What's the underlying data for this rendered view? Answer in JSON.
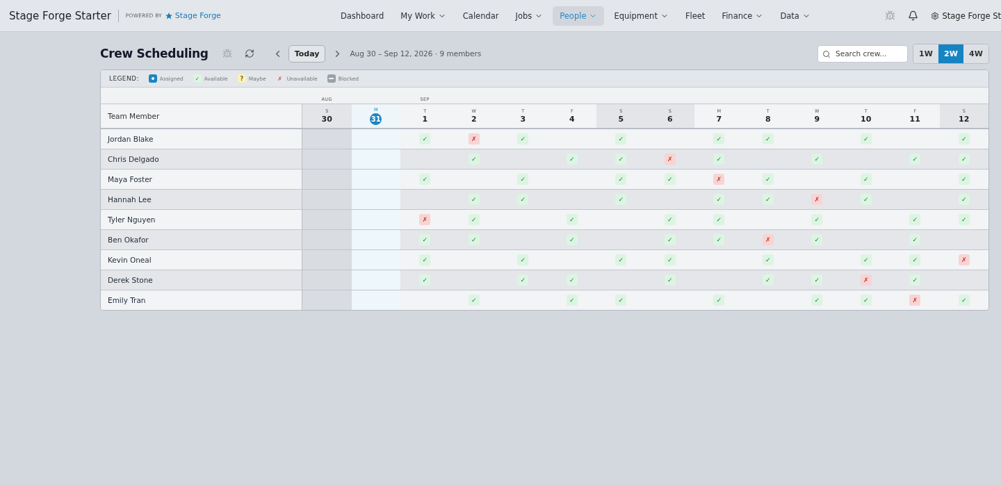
{
  "brand": {
    "title": "Stage Forge Starter",
    "powered_by": "POWERED BY",
    "partner": "Stage Forge"
  },
  "nav": [
    {
      "label": "Dashboard",
      "dropdown": false,
      "selected": false
    },
    {
      "label": "My Work",
      "dropdown": true,
      "selected": false
    },
    {
      "label": "Calendar",
      "dropdown": false,
      "selected": false
    },
    {
      "label": "Jobs",
      "dropdown": true,
      "selected": false
    },
    {
      "label": "People",
      "dropdown": true,
      "selected": true
    },
    {
      "label": "Equipment",
      "dropdown": true,
      "selected": false
    },
    {
      "label": "Fleet",
      "dropdown": false,
      "selected": false
    },
    {
      "label": "Finance",
      "dropdown": true,
      "selected": false
    },
    {
      "label": "Data",
      "dropdown": true,
      "selected": false
    }
  ],
  "account": "Stage Forge St",
  "page": {
    "title": "Crew Scheduling",
    "today_button": "Today",
    "range": "Aug 30 – Sep 12, 2026 · 9 members",
    "search": {
      "placeholder": "Search crew..."
    },
    "views": [
      {
        "label": "1W",
        "selected": false
      },
      {
        "label": "2W",
        "selected": true
      },
      {
        "label": "4W",
        "selected": false
      }
    ]
  },
  "legend": {
    "label": "LEGEND:",
    "items": [
      {
        "kind": "assigned",
        "label": "Assigned"
      },
      {
        "kind": "available",
        "mark": "✓",
        "label": "Available"
      },
      {
        "kind": "maybe",
        "mark": "?",
        "label": "Maybe"
      },
      {
        "kind": "unavailable",
        "mark": "✗",
        "label": "Unavailable"
      },
      {
        "kind": "blocked",
        "label": "Blocked"
      }
    ]
  },
  "grid": {
    "member_header": "Team Member",
    "days": [
      {
        "month": "AUG",
        "weekday": "S",
        "date": "30",
        "weekend": true,
        "today": false
      },
      {
        "weekday": "M",
        "date": "31",
        "weekend": false,
        "today": true
      },
      {
        "month": "SEP",
        "weekday": "T",
        "date": "1",
        "weekend": false,
        "today": false
      },
      {
        "weekday": "W",
        "date": "2",
        "weekend": false,
        "today": false
      },
      {
        "weekday": "T",
        "date": "3",
        "weekend": false,
        "today": false
      },
      {
        "weekday": "F",
        "date": "4",
        "weekend": false,
        "today": false
      },
      {
        "weekday": "S",
        "date": "5",
        "weekend": true,
        "today": false
      },
      {
        "weekday": "S",
        "date": "6",
        "weekend": true,
        "today": false
      },
      {
        "weekday": "M",
        "date": "7",
        "weekend": false,
        "today": false
      },
      {
        "weekday": "T",
        "date": "8",
        "weekend": false,
        "today": false
      },
      {
        "weekday": "W",
        "date": "9",
        "weekend": false,
        "today": false
      },
      {
        "weekday": "T",
        "date": "10",
        "weekend": false,
        "today": false
      },
      {
        "weekday": "F",
        "date": "11",
        "weekend": false,
        "today": false
      },
      {
        "weekday": "S",
        "date": "12",
        "weekend": true,
        "today": false
      }
    ],
    "rows": [
      {
        "name": "Jordan Blake",
        "cells": [
          null,
          null,
          {
            "kind": "available",
            "mark": "✓"
          },
          {
            "kind": "unavailable",
            "mark": "✗"
          },
          {
            "kind": "available",
            "mark": "✓"
          },
          null,
          {
            "kind": "available",
            "mark": "✓"
          },
          null,
          {
            "kind": "available",
            "mark": "✓"
          },
          {
            "kind": "available",
            "mark": "✓"
          },
          null,
          {
            "kind": "available",
            "mark": "✓"
          },
          null,
          {
            "kind": "available",
            "mark": "✓"
          }
        ]
      },
      {
        "name": "Chris Delgado",
        "cells": [
          null,
          null,
          null,
          {
            "kind": "available",
            "mark": "✓"
          },
          null,
          {
            "kind": "available",
            "mark": "✓"
          },
          {
            "kind": "available",
            "mark": "✓"
          },
          {
            "kind": "unavailable",
            "mark": "✗"
          },
          {
            "kind": "available",
            "mark": "✓"
          },
          null,
          {
            "kind": "available",
            "mark": "✓"
          },
          null,
          {
            "kind": "available",
            "mark": "✓"
          },
          {
            "kind": "available",
            "mark": "✓"
          }
        ]
      },
      {
        "name": "Maya Foster",
        "cells": [
          null,
          null,
          {
            "kind": "available",
            "mark": "✓"
          },
          null,
          {
            "kind": "available",
            "mark": "✓"
          },
          null,
          {
            "kind": "available",
            "mark": "✓"
          },
          {
            "kind": "available",
            "mark": "✓"
          },
          {
            "kind": "unavailable",
            "mark": "✗"
          },
          {
            "kind": "available",
            "mark": "✓"
          },
          null,
          {
            "kind": "available",
            "mark": "✓"
          },
          null,
          {
            "kind": "available",
            "mark": "✓"
          }
        ]
      },
      {
        "name": "Hannah Lee",
        "cells": [
          null,
          null,
          null,
          {
            "kind": "available",
            "mark": "✓"
          },
          {
            "kind": "available",
            "mark": "✓"
          },
          null,
          {
            "kind": "available",
            "mark": "✓"
          },
          null,
          {
            "kind": "available",
            "mark": "✓"
          },
          {
            "kind": "available",
            "mark": "✓"
          },
          {
            "kind": "unavailable",
            "mark": "✗"
          },
          {
            "kind": "available",
            "mark": "✓"
          },
          null,
          {
            "kind": "available",
            "mark": "✓"
          }
        ]
      },
      {
        "name": "Tyler Nguyen",
        "cells": [
          null,
          null,
          {
            "kind": "unavailable",
            "mark": "✗"
          },
          {
            "kind": "available",
            "mark": "✓"
          },
          null,
          {
            "kind": "available",
            "mark": "✓"
          },
          null,
          {
            "kind": "available",
            "mark": "✓"
          },
          {
            "kind": "available",
            "mark": "✓"
          },
          null,
          {
            "kind": "available",
            "mark": "✓"
          },
          null,
          {
            "kind": "available",
            "mark": "✓"
          },
          {
            "kind": "available",
            "mark": "✓"
          }
        ]
      },
      {
        "name": "Ben Okafor",
        "cells": [
          null,
          null,
          {
            "kind": "available",
            "mark": "✓"
          },
          {
            "kind": "available",
            "mark": "✓"
          },
          null,
          {
            "kind": "available",
            "mark": "✓"
          },
          null,
          {
            "kind": "available",
            "mark": "✓"
          },
          {
            "kind": "available",
            "mark": "✓"
          },
          {
            "kind": "unavailable",
            "mark": "✗"
          },
          {
            "kind": "available",
            "mark": "✓"
          },
          null,
          {
            "kind": "available",
            "mark": "✓"
          },
          null
        ]
      },
      {
        "name": "Kevin Oneal",
        "cells": [
          null,
          null,
          {
            "kind": "available",
            "mark": "✓"
          },
          null,
          {
            "kind": "available",
            "mark": "✓"
          },
          null,
          {
            "kind": "available",
            "mark": "✓"
          },
          {
            "kind": "available",
            "mark": "✓"
          },
          null,
          {
            "kind": "available",
            "mark": "✓"
          },
          null,
          {
            "kind": "available",
            "mark": "✓"
          },
          {
            "kind": "available",
            "mark": "✓"
          },
          {
            "kind": "unavailable",
            "mark": "✗"
          }
        ]
      },
      {
        "name": "Derek Stone",
        "cells": [
          null,
          null,
          {
            "kind": "available",
            "mark": "✓"
          },
          null,
          {
            "kind": "available",
            "mark": "✓"
          },
          {
            "kind": "available",
            "mark": "✓"
          },
          null,
          {
            "kind": "available",
            "mark": "✓"
          },
          null,
          {
            "kind": "available",
            "mark": "✓"
          },
          {
            "kind": "available",
            "mark": "✓"
          },
          {
            "kind": "unavailable",
            "mark": "✗"
          },
          {
            "kind": "available",
            "mark": "✓"
          },
          null
        ]
      },
      {
        "name": "Emily Tran",
        "cells": [
          null,
          null,
          null,
          {
            "kind": "available",
            "mark": "✓"
          },
          null,
          {
            "kind": "available",
            "mark": "✓"
          },
          {
            "kind": "available",
            "mark": "✓"
          },
          null,
          {
            "kind": "available",
            "mark": "✓"
          },
          null,
          {
            "kind": "available",
            "mark": "✓"
          },
          {
            "kind": "available",
            "mark": "✓"
          },
          {
            "kind": "unavailable",
            "mark": "✗"
          },
          {
            "kind": "available",
            "mark": "✓"
          }
        ]
      }
    ]
  }
}
